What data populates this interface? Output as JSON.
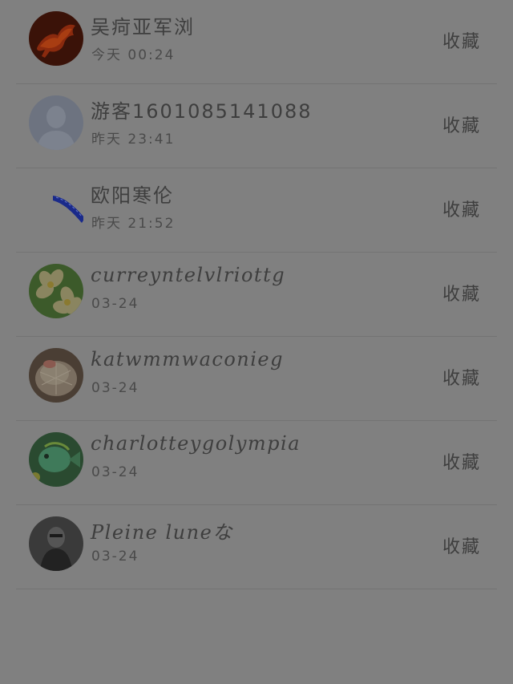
{
  "rows": [
    {
      "name": "吴疴亚军浏",
      "time": "今天 00:24",
      "action": "收藏",
      "avatar": "flame-horse-avatar",
      "avatar_color": "#6b1f0e"
    },
    {
      "name": "游客1601085141088",
      "time": "昨天 23:41",
      "action": "收藏",
      "avatar": "default-user-avatar",
      "avatar_color": "#6d7380"
    },
    {
      "name": "欧阳寒伦",
      "time": "昨天 21:52",
      "action": "收藏",
      "avatar": "blue-ribbon-badge",
      "avatar_color": "#1a2a8a"
    },
    {
      "name": "curreyntelvlriottg",
      "time": "03-24",
      "action": "收藏",
      "avatar": "frangipani-flower-avatar",
      "avatar_color": "#3c5a2a"
    },
    {
      "name": "katwmmwaconieg",
      "time": "03-24",
      "action": "收藏",
      "avatar": "cactus-avatar",
      "avatar_color": "#5a4a3e"
    },
    {
      "name": "charlotteygolympia",
      "time": "03-24",
      "action": "收藏",
      "avatar": "green-fish-avatar",
      "avatar_color": "#2f5a3a"
    },
    {
      "name": "Pleine luneな",
      "time": "03-24",
      "action": "收藏",
      "avatar": "dark-portrait-avatar",
      "avatar_color": "#2a2a2a"
    }
  ]
}
